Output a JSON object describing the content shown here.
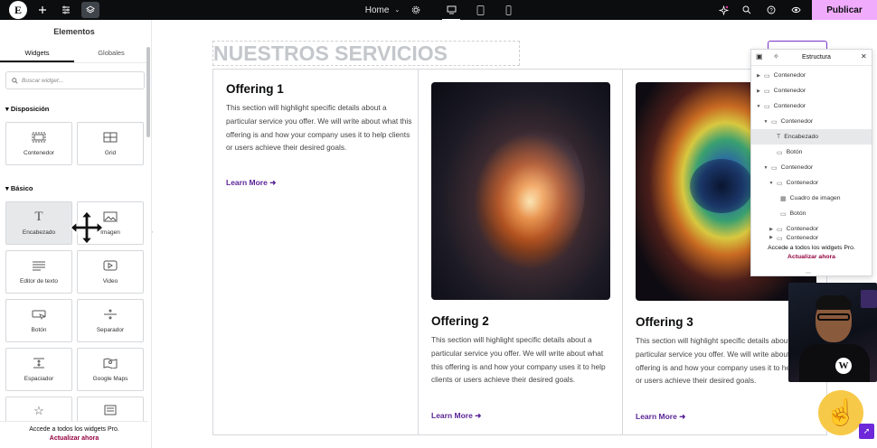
{
  "topbar": {
    "logo": "E",
    "page_label": "Home",
    "publish_label": "Publicar"
  },
  "left_panel": {
    "title": "Elementos",
    "tabs": [
      "Widgets",
      "Globales"
    ],
    "search_placeholder": "Buscar widget...",
    "categories": {
      "layout": "Disposición",
      "basic": "Básico"
    },
    "widgets": {
      "container": "Contenedor",
      "grid": "Grid",
      "heading": "Encabezado",
      "image": "Imagen",
      "text_editor": "Editor de texto",
      "video": "Video",
      "button": "Botón",
      "divider": "Separador",
      "spacer": "Espaciador",
      "google_maps": "Google Maps"
    },
    "promo": {
      "text": "Accede a todos los widgets Pro.",
      "link": "Actualizar ahora"
    }
  },
  "canvas": {
    "heading": "NUESTROS SERVICIOS",
    "offerings": [
      {
        "title": "Offering 1",
        "body": "This section will highlight specific details about a particular service you offer. We will write about what this offering is and how your company uses it to help clients or users achieve their desired goals.",
        "link": "Learn More"
      },
      {
        "title": "Offering 2",
        "body": "This section will highlight specific details about a particular service you offer. We will write about what this offering is and how your company uses it to help clients or users achieve their desired goals.",
        "link": "Learn More"
      },
      {
        "title": "Offering 3",
        "body": "This section will highlight specific details about a particular service you offer. We will write about what this offering is and how your company uses it to help clients or users achieve their desired goals.",
        "link": "Learn More"
      }
    ]
  },
  "structure_panel": {
    "title": "Estructura",
    "nodes": [
      {
        "label": "Contenedor",
        "icon": "container-icon"
      },
      {
        "label": "Contenedor",
        "icon": "container-icon"
      },
      {
        "label": "Contenedor",
        "icon": "container-icon"
      },
      {
        "label": "Contenedor",
        "icon": "container-icon"
      },
      {
        "label": "Encabezado",
        "icon": "heading-icon"
      },
      {
        "label": "Botón",
        "icon": "button-icon"
      },
      {
        "label": "Contenedor",
        "icon": "container-icon"
      },
      {
        "label": "Contenedor",
        "icon": "container-icon"
      },
      {
        "label": "Cuadro de imagen",
        "icon": "image-box-icon"
      },
      {
        "label": "Botón",
        "icon": "button-icon"
      },
      {
        "label": "Contenedor",
        "icon": "container-icon"
      },
      {
        "label": "Contenedor",
        "icon": "container-icon"
      }
    ],
    "promo": {
      "text": "Accede a todos los widgets Pro.",
      "link": "Actualizar ahora"
    }
  },
  "colors": {
    "topbar": "#0c0d0e",
    "publish": "#f0abfc",
    "link_purple": "#5b2497",
    "upgrade": "#93003f"
  }
}
